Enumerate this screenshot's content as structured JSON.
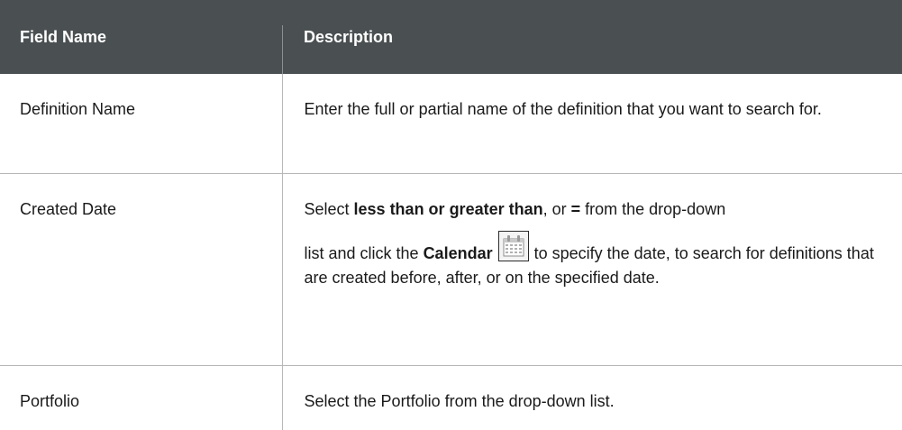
{
  "table": {
    "headers": {
      "field_name": "Field Name",
      "description": "Description"
    },
    "rows": [
      {
        "name": "Definition Name",
        "description": "Enter the full or partial name of the definition that you want to search for."
      },
      {
        "name": "Created Date",
        "desc_parts": {
          "p1": "Select ",
          "b1": "less than or greater than",
          "p2": ", or ",
          "b2": "=",
          "p3": " from the drop-down",
          "p4": "list and click the ",
          "b3": "Calendar",
          "p5": " to specify the date, to search for definitions that are created before, after, or on the specified date."
        }
      },
      {
        "name": "Portfolio",
        "description": "Select the Portfolio from the drop-down list."
      }
    ]
  },
  "icons": {
    "calendar": "calendar-icon"
  },
  "colors": {
    "header_bg": "#4a5052",
    "header_text": "#ffffff",
    "border": "#b8b8b8"
  }
}
